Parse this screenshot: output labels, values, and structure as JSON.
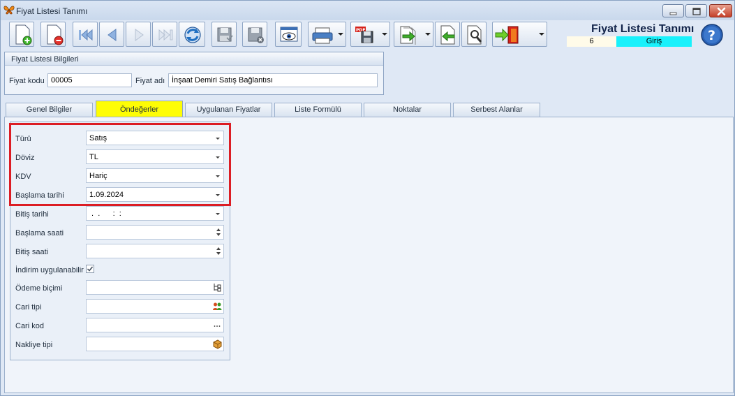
{
  "window": {
    "title": "Fiyat Listesi Tanımı"
  },
  "toolbar": {
    "buttons": [
      "add-icon",
      "delete-icon",
      "first-record-icon",
      "previous-record-icon",
      "next-record-icon",
      "last-record-icon",
      "refresh-icon",
      "save-icon",
      "cancel-save-icon",
      "preview-icon",
      "print-icon",
      "pdf-export-icon",
      "export-icon",
      "import-icon",
      "find-icon",
      "exit-icon"
    ]
  },
  "header": {
    "app_title": "Fiyat Listesi Tanımı",
    "record_number": "6",
    "mode": "Giriş"
  },
  "info_group": {
    "title": "Fiyat Listesi Bilgileri",
    "code_label": "Fiyat kodu",
    "code_value": "00005",
    "name_label": "Fiyat adı",
    "name_value": "İnşaat Demiri Satış Bağlantısı"
  },
  "tabs": [
    {
      "label": "Genel Bilgiler",
      "active": false
    },
    {
      "label": "Öndeğerler",
      "active": true
    },
    {
      "label": "Uygulanan Fiyatlar",
      "active": false
    },
    {
      "label": "Liste Formülü",
      "active": false
    },
    {
      "label": "Noktalar",
      "active": false
    },
    {
      "label": "Serbest Alanlar",
      "active": false
    }
  ],
  "defaults": {
    "type_label": "Türü",
    "type_value": "Satış",
    "currency_label": "Döviz",
    "currency_value": "TL",
    "vat_label": "KDV",
    "vat_value": "Hariç",
    "start_date_label": "Başlama tarihi",
    "start_date_value": "1.09.2024",
    "end_date_label": "Bitiş tarihi",
    "end_date_value": " .  .      :  :",
    "start_time_label": "Başlama saati",
    "start_time_value": "",
    "end_time_label": "Bitiş saati",
    "end_time_value": "",
    "discount_label": "İndirim uygulanabilir",
    "discount_checked": true,
    "payment_label": "Ödeme biçimi",
    "payment_value": "",
    "customer_type_label": "Cari tipi",
    "customer_type_value": "",
    "customer_code_label": "Cari kod",
    "customer_code_value": "",
    "shipping_label": "Nakliye tipi",
    "shipping_value": ""
  },
  "colors": {
    "active_tab": "#fefd04",
    "mode_background": "#19f1fb",
    "highlight_border": "#dc1d24"
  }
}
